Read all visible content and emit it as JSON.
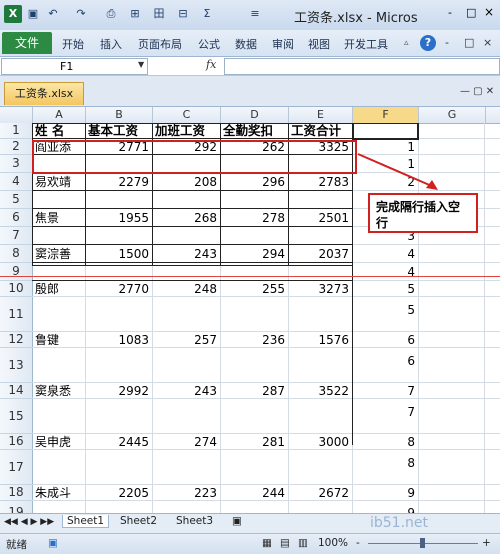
{
  "window": {
    "title": "工资条.xlsx - Micros",
    "logo": "X",
    "controls": [
      "-",
      "□",
      "×"
    ]
  },
  "quick_access": [
    "save-icon",
    "undo-icon",
    "redo-icon",
    "print-preview-icon",
    "format-icon",
    "filter-icon",
    "border-icon",
    "sum-icon",
    "merge-icon"
  ],
  "qa_glyphs": [
    "▣",
    "↶",
    "↷",
    "⎙",
    "⊞",
    "Σ",
    "⊟",
    "田",
    "≡"
  ],
  "ribbon": {
    "file_tab": "文件",
    "tabs": [
      "开始",
      "插入",
      "页面布局",
      "公式",
      "数据",
      "审阅",
      "视图",
      "开发工具"
    ],
    "help": "?"
  },
  "formula_bar": {
    "cell_ref": "F1",
    "fx": "fx",
    "value": ""
  },
  "workbook_tab": "工资条.xlsx",
  "columns": [
    "A",
    "B",
    "C",
    "D",
    "E",
    "F",
    "G"
  ],
  "rows": [
    "1",
    "2",
    "3",
    "4",
    "5",
    "6",
    "7",
    "8",
    "9",
    "10",
    "11",
    "12",
    "13",
    "14",
    "15",
    "16",
    "17",
    "18",
    "19"
  ],
  "headers": [
    "姓 名",
    "基本工资",
    "加班工资",
    "全勤奖扣",
    "工资合计"
  ],
  "records": [
    [
      "阎亚添",
      "2771",
      "292",
      "262",
      "3325"
    ],
    [
      "易欢靖",
      "2279",
      "208",
      "296",
      "2783"
    ],
    [
      "焦景",
      "1955",
      "268",
      "278",
      "2501"
    ],
    [
      "窦淙善",
      "1500",
      "243",
      "294",
      "2037"
    ],
    [
      "殷郎",
      "2770",
      "248",
      "255",
      "3273"
    ],
    [
      "鲁键",
      "1083",
      "257",
      "236",
      "1576"
    ],
    [
      "窦泉悉",
      "2992",
      "243",
      "287",
      "3522"
    ],
    [
      "吴申虎",
      "2445",
      "274",
      "281",
      "3000"
    ],
    [
      "朱成斗",
      "2205",
      "223",
      "244",
      "2672"
    ]
  ],
  "helper_column": [
    "1",
    "1",
    "2",
    "2",
    "3",
    "3",
    "4",
    "4",
    "5",
    "5",
    "6",
    "6",
    "7",
    "7",
    "8",
    "8",
    "9",
    "9"
  ],
  "callout": "完成隔行插入空行",
  "sheets": [
    "Sheet1",
    "Sheet2",
    "Sheet3"
  ],
  "status": {
    "ready": "就绪",
    "zoom": "100%",
    "zoom_minus": "-",
    "zoom_plus": "+"
  },
  "watermark": "ib51.net"
}
